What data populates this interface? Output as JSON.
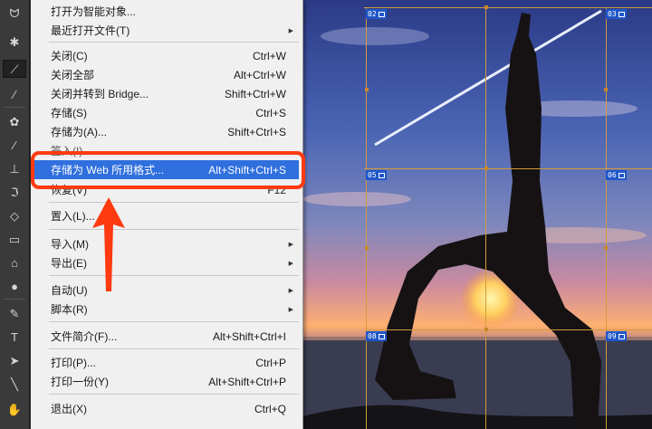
{
  "toolbar": {
    "icons": [
      "lasso-icon",
      "magic-wand-icon",
      "crop-icon",
      "eyedropper-icon",
      "healing-brush-icon",
      "brush-icon",
      "stamp-icon",
      "history-brush-icon",
      "eraser-icon",
      "gradient-icon",
      "blur-icon",
      "dodge-icon",
      "pen-icon",
      "type-icon",
      "path-select-icon",
      "line-icon",
      "hand-icon"
    ]
  },
  "menu": {
    "items": [
      {
        "label": "打开为智能对象...",
        "shortcut": ""
      },
      {
        "label": "最近打开文件(T)",
        "shortcut": "",
        "submenu": true
      },
      {
        "label": "关闭(C)",
        "shortcut": "Ctrl+W"
      },
      {
        "label": "关闭全部",
        "shortcut": "Alt+Ctrl+W"
      },
      {
        "label": "关闭并转到 Bridge...",
        "shortcut": "Shift+Ctrl+W"
      },
      {
        "label": "存储(S)",
        "shortcut": "Ctrl+S"
      },
      {
        "label": "存储为(A)...",
        "shortcut": "Shift+Ctrl+S"
      },
      {
        "label": "签入(I)...",
        "shortcut": ""
      },
      {
        "label": "存储为 Web 所用格式...",
        "shortcut": "Alt+Shift+Ctrl+S"
      },
      {
        "label": "恢复(V)",
        "shortcut": "F12"
      },
      {
        "label": "置入(L)...",
        "shortcut": ""
      },
      {
        "label": "导入(M)",
        "shortcut": "",
        "submenu": true
      },
      {
        "label": "导出(E)",
        "shortcut": "",
        "submenu": true
      },
      {
        "label": "自动(U)",
        "shortcut": "",
        "submenu": true
      },
      {
        "label": "脚本(R)",
        "shortcut": "",
        "submenu": true
      },
      {
        "label": "文件简介(F)...",
        "shortcut": "Alt+Shift+Ctrl+I"
      },
      {
        "label": "打印(P)...",
        "shortcut": "Ctrl+P"
      },
      {
        "label": "打印一份(Y)",
        "shortcut": "Alt+Shift+Ctrl+P"
      },
      {
        "label": "退出(X)",
        "shortcut": "Ctrl+Q"
      }
    ],
    "submenu_arrow": "▶"
  },
  "slices": [
    "02",
    "03",
    "05",
    "06",
    "08",
    "09"
  ],
  "colors": {
    "highlight": "#2f6fde",
    "callout": "#ff3a10",
    "slice_tag": "#1f57c8",
    "guide": "#d39a39"
  }
}
